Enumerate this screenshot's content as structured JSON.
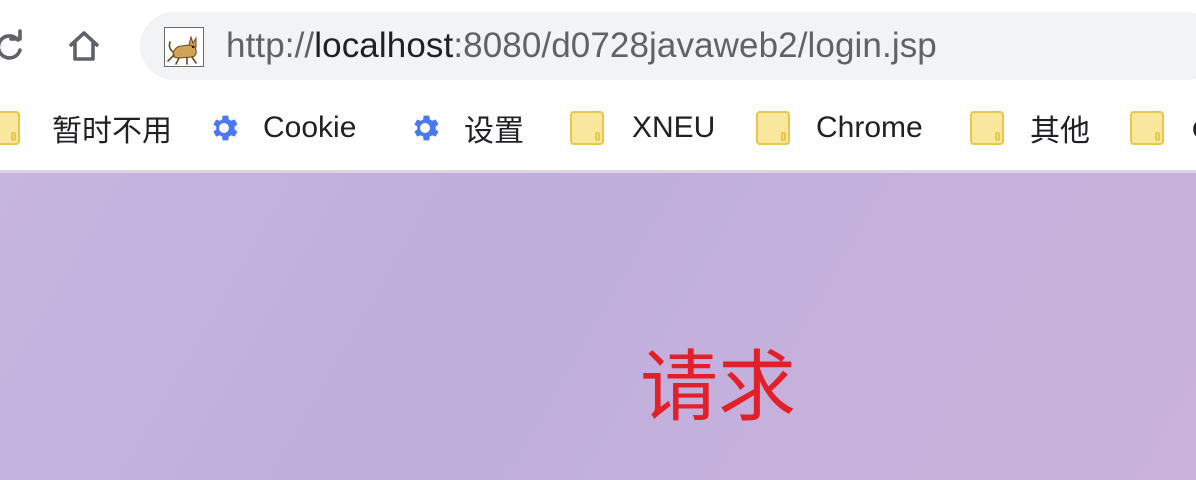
{
  "browser": {
    "address_bar": {
      "url_prefix": "http://",
      "url_host": "localhost",
      "url_rest": ":8080/d0728javaweb2/login.jsp",
      "favicon": "tomcat-icon"
    },
    "nav": {
      "reload_icon": "reload-icon",
      "home_icon": "home-icon"
    },
    "bookmarks": [
      {
        "label": "暂时不用",
        "icon": "folder-icon"
      },
      {
        "label": "Cookie",
        "icon": "gear-icon"
      },
      {
        "label": "设置",
        "icon": "gear-icon"
      },
      {
        "label": "XNEU",
        "icon": "folder-icon"
      },
      {
        "label": "Chrome",
        "icon": "folder-icon"
      },
      {
        "label": "其他",
        "icon": "folder-icon"
      },
      {
        "label": "c",
        "icon": "folder-icon"
      }
    ]
  },
  "page": {
    "heading": "请求"
  },
  "colors": {
    "omnibox_bg": "#f1f3f4",
    "gear_blue": "#4a78f0",
    "folder_fill": "#f8e79c",
    "folder_stroke": "#e6c94a",
    "page_bg": "#c4b2dd",
    "heading_red": "#e2202a"
  }
}
